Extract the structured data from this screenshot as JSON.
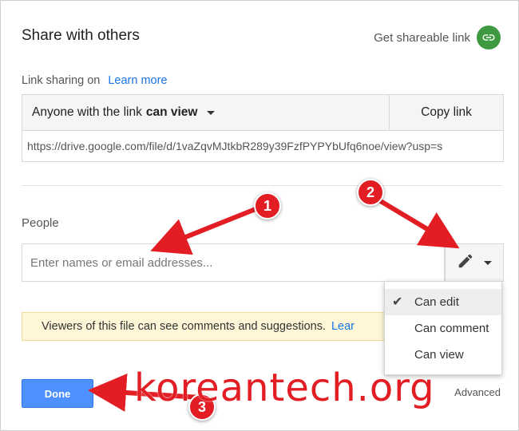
{
  "dialog": {
    "title": "Share with others",
    "shareable_link_label": "Get shareable link"
  },
  "link_sharing": {
    "label": "Link sharing on",
    "learn_more": "Learn more",
    "access_prefix": "Anyone with the link",
    "access_level": "can view",
    "copy_link": "Copy link",
    "url": "https://drive.google.com/file/d/1vaZqvMJtkbR289y39FzfPYPYbUfq6noe/view?usp=s"
  },
  "people": {
    "label": "People",
    "placeholder": "Enter names or email addresses..."
  },
  "notice": {
    "text": "Viewers of this file can see comments and suggestions.",
    "link": "Lear"
  },
  "permission_menu": {
    "items": [
      {
        "label": "Can edit",
        "checked": true
      },
      {
        "label": "Can comment",
        "checked": false
      },
      {
        "label": "Can view",
        "checked": false
      }
    ]
  },
  "footer": {
    "done": "Done",
    "advanced": "Advanced"
  },
  "annotations": {
    "badge1": "1",
    "badge2": "2",
    "badge3": "3",
    "watermark": "koreantech.org"
  },
  "colors": {
    "accent_blue": "#4d90fe",
    "link_blue": "#1a73e8",
    "link_icon_green": "#3d9a40",
    "annotation_red": "#e21d24",
    "notice_bg": "#fef6d6"
  }
}
